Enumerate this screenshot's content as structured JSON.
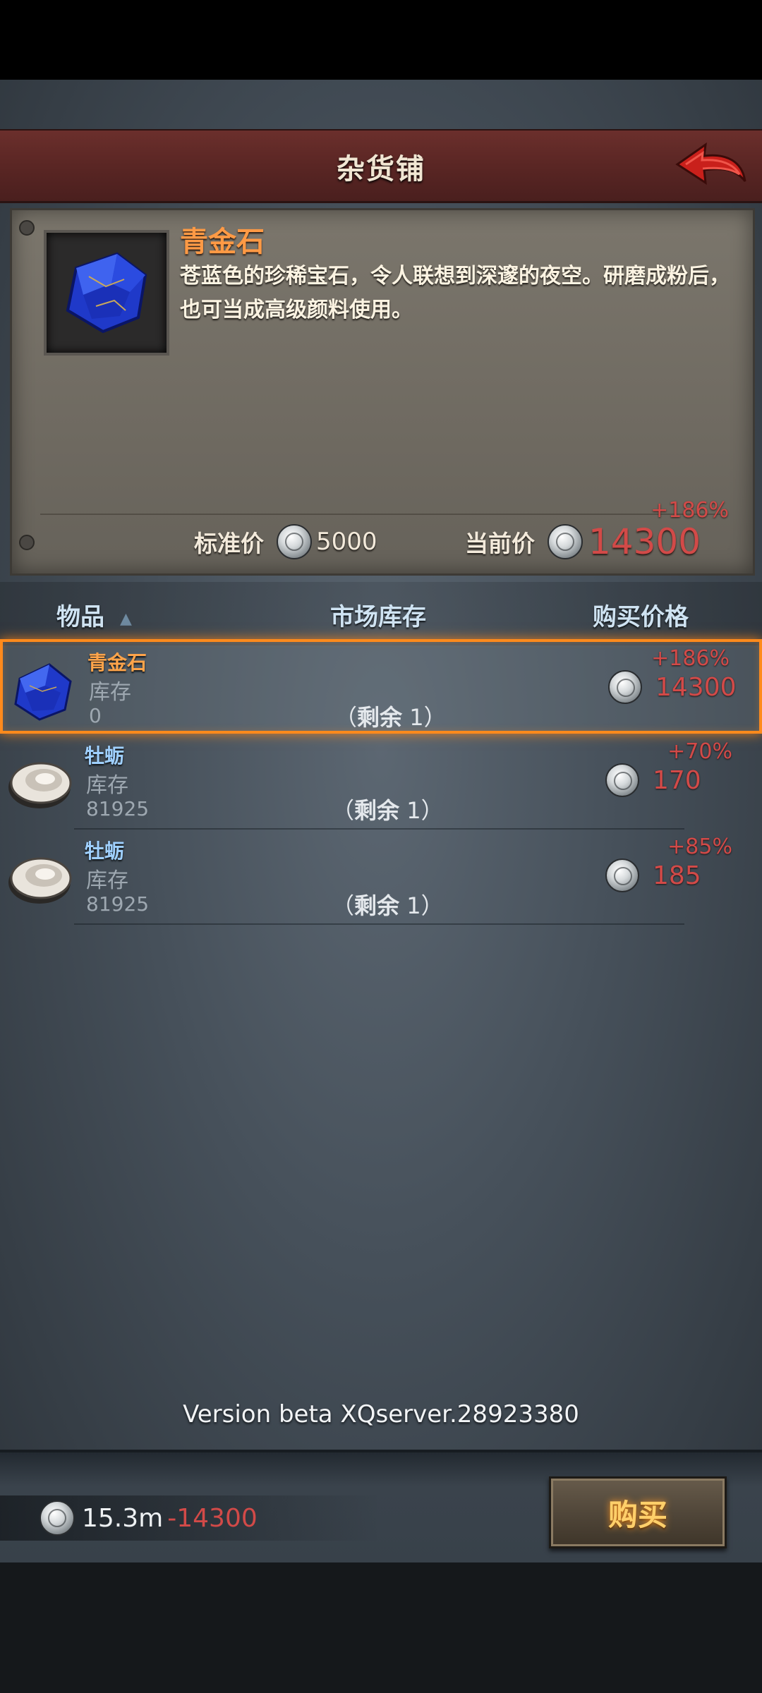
{
  "header": {
    "title": "杂货铺"
  },
  "detail": {
    "name": "青金石",
    "description": "苍蓝色的珍稀宝石，令人联想到深邃的夜空。研磨成粉后，也可当成高级颜料使用。",
    "standard_price_label": "标准价",
    "standard_price": "5000",
    "current_price_label": "当前价",
    "current_price": "14300",
    "price_change": "+186%"
  },
  "table": {
    "headers": {
      "item": "物品",
      "stock": "市场库存",
      "price": "购买价格"
    },
    "rows": [
      {
        "name": "青金石",
        "stock_label": "库存",
        "stock": "0",
        "remain_label": "剩余",
        "remain": "1",
        "change": "+186%",
        "price": "14300",
        "icon": "lapis-lazuli-icon",
        "name_color": "#ffa44a"
      },
      {
        "name": "牡蛎",
        "stock_label": "库存",
        "stock": "81925",
        "remain_label": "剩余",
        "remain": "1",
        "change": "+70%",
        "price": "170",
        "icon": "oyster-icon",
        "name_color": "#9fd0ff"
      },
      {
        "name": "牡蛎",
        "stock_label": "库存",
        "stock": "81925",
        "remain_label": "剩余",
        "remain": "1",
        "change": "+85%",
        "price": "185",
        "icon": "oyster-icon",
        "name_color": "#9fd0ff"
      }
    ]
  },
  "version": "Version beta XQserver.28923380",
  "footer": {
    "balance": "15.3m",
    "cost": "-14300",
    "buy_label": "购买"
  },
  "colors": {
    "header": "#5a2624",
    "price_red": "#d24a48",
    "highlight": "#ff8a1c"
  }
}
